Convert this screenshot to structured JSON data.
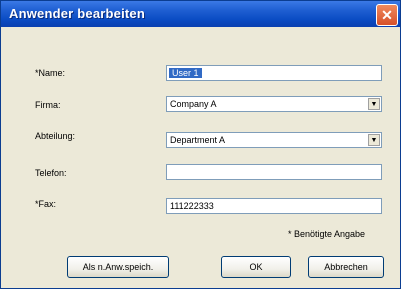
{
  "window": {
    "title": "Anwender bearbeiten"
  },
  "form": {
    "name_label": "*Name:",
    "name_value": "User 1",
    "firma_label": "Firma:",
    "firma_value": "Company A",
    "abteilung_label": "Abteilung:",
    "abteilung_value": "Department A",
    "telefon_label": "Telefon:",
    "telefon_value": "",
    "fax_label": "*Fax:",
    "fax_value": "111222333",
    "required_note": "* Benötigte Angabe"
  },
  "buttons": {
    "save_new_label": "Als n.Anw.speich.",
    "ok_label": "OK",
    "cancel_label": "Abbrechen"
  },
  "icons": {
    "close": "close-icon",
    "dropdown": "chevron-down-icon"
  }
}
